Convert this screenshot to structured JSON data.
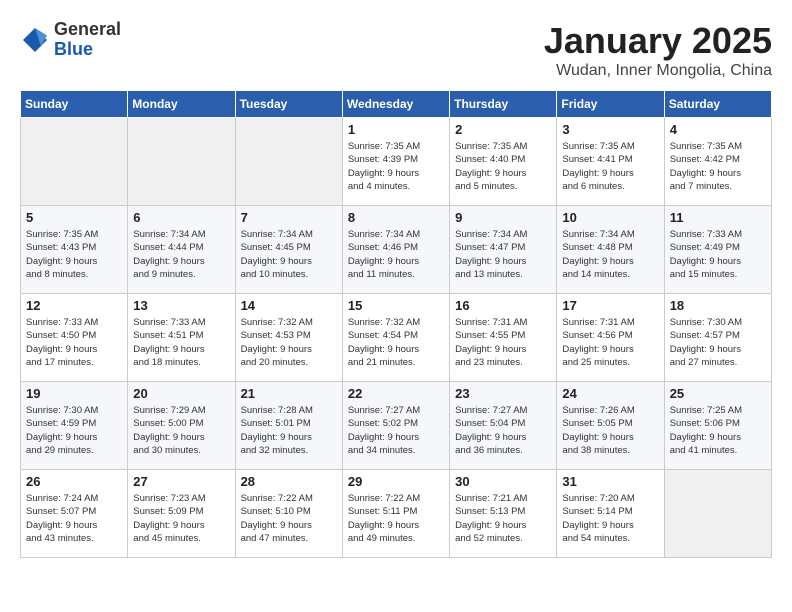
{
  "logo": {
    "general": "General",
    "blue": "Blue"
  },
  "title": "January 2025",
  "subtitle": "Wudan, Inner Mongolia, China",
  "days_of_week": [
    "Sunday",
    "Monday",
    "Tuesday",
    "Wednesday",
    "Thursday",
    "Friday",
    "Saturday"
  ],
  "weeks": [
    [
      {
        "day": "",
        "info": ""
      },
      {
        "day": "",
        "info": ""
      },
      {
        "day": "",
        "info": ""
      },
      {
        "day": "1",
        "info": "Sunrise: 7:35 AM\nSunset: 4:39 PM\nDaylight: 9 hours\nand 4 minutes."
      },
      {
        "day": "2",
        "info": "Sunrise: 7:35 AM\nSunset: 4:40 PM\nDaylight: 9 hours\nand 5 minutes."
      },
      {
        "day": "3",
        "info": "Sunrise: 7:35 AM\nSunset: 4:41 PM\nDaylight: 9 hours\nand 6 minutes."
      },
      {
        "day": "4",
        "info": "Sunrise: 7:35 AM\nSunset: 4:42 PM\nDaylight: 9 hours\nand 7 minutes."
      }
    ],
    [
      {
        "day": "5",
        "info": "Sunrise: 7:35 AM\nSunset: 4:43 PM\nDaylight: 9 hours\nand 8 minutes."
      },
      {
        "day": "6",
        "info": "Sunrise: 7:34 AM\nSunset: 4:44 PM\nDaylight: 9 hours\nand 9 minutes."
      },
      {
        "day": "7",
        "info": "Sunrise: 7:34 AM\nSunset: 4:45 PM\nDaylight: 9 hours\nand 10 minutes."
      },
      {
        "day": "8",
        "info": "Sunrise: 7:34 AM\nSunset: 4:46 PM\nDaylight: 9 hours\nand 11 minutes."
      },
      {
        "day": "9",
        "info": "Sunrise: 7:34 AM\nSunset: 4:47 PM\nDaylight: 9 hours\nand 13 minutes."
      },
      {
        "day": "10",
        "info": "Sunrise: 7:34 AM\nSunset: 4:48 PM\nDaylight: 9 hours\nand 14 minutes."
      },
      {
        "day": "11",
        "info": "Sunrise: 7:33 AM\nSunset: 4:49 PM\nDaylight: 9 hours\nand 15 minutes."
      }
    ],
    [
      {
        "day": "12",
        "info": "Sunrise: 7:33 AM\nSunset: 4:50 PM\nDaylight: 9 hours\nand 17 minutes."
      },
      {
        "day": "13",
        "info": "Sunrise: 7:33 AM\nSunset: 4:51 PM\nDaylight: 9 hours\nand 18 minutes."
      },
      {
        "day": "14",
        "info": "Sunrise: 7:32 AM\nSunset: 4:53 PM\nDaylight: 9 hours\nand 20 minutes."
      },
      {
        "day": "15",
        "info": "Sunrise: 7:32 AM\nSunset: 4:54 PM\nDaylight: 9 hours\nand 21 minutes."
      },
      {
        "day": "16",
        "info": "Sunrise: 7:31 AM\nSunset: 4:55 PM\nDaylight: 9 hours\nand 23 minutes."
      },
      {
        "day": "17",
        "info": "Sunrise: 7:31 AM\nSunset: 4:56 PM\nDaylight: 9 hours\nand 25 minutes."
      },
      {
        "day": "18",
        "info": "Sunrise: 7:30 AM\nSunset: 4:57 PM\nDaylight: 9 hours\nand 27 minutes."
      }
    ],
    [
      {
        "day": "19",
        "info": "Sunrise: 7:30 AM\nSunset: 4:59 PM\nDaylight: 9 hours\nand 29 minutes."
      },
      {
        "day": "20",
        "info": "Sunrise: 7:29 AM\nSunset: 5:00 PM\nDaylight: 9 hours\nand 30 minutes."
      },
      {
        "day": "21",
        "info": "Sunrise: 7:28 AM\nSunset: 5:01 PM\nDaylight: 9 hours\nand 32 minutes."
      },
      {
        "day": "22",
        "info": "Sunrise: 7:27 AM\nSunset: 5:02 PM\nDaylight: 9 hours\nand 34 minutes."
      },
      {
        "day": "23",
        "info": "Sunrise: 7:27 AM\nSunset: 5:04 PM\nDaylight: 9 hours\nand 36 minutes."
      },
      {
        "day": "24",
        "info": "Sunrise: 7:26 AM\nSunset: 5:05 PM\nDaylight: 9 hours\nand 38 minutes."
      },
      {
        "day": "25",
        "info": "Sunrise: 7:25 AM\nSunset: 5:06 PM\nDaylight: 9 hours\nand 41 minutes."
      }
    ],
    [
      {
        "day": "26",
        "info": "Sunrise: 7:24 AM\nSunset: 5:07 PM\nDaylight: 9 hours\nand 43 minutes."
      },
      {
        "day": "27",
        "info": "Sunrise: 7:23 AM\nSunset: 5:09 PM\nDaylight: 9 hours\nand 45 minutes."
      },
      {
        "day": "28",
        "info": "Sunrise: 7:22 AM\nSunset: 5:10 PM\nDaylight: 9 hours\nand 47 minutes."
      },
      {
        "day": "29",
        "info": "Sunrise: 7:22 AM\nSunset: 5:11 PM\nDaylight: 9 hours\nand 49 minutes."
      },
      {
        "day": "30",
        "info": "Sunrise: 7:21 AM\nSunset: 5:13 PM\nDaylight: 9 hours\nand 52 minutes."
      },
      {
        "day": "31",
        "info": "Sunrise: 7:20 AM\nSunset: 5:14 PM\nDaylight: 9 hours\nand 54 minutes."
      },
      {
        "day": "",
        "info": ""
      }
    ]
  ]
}
